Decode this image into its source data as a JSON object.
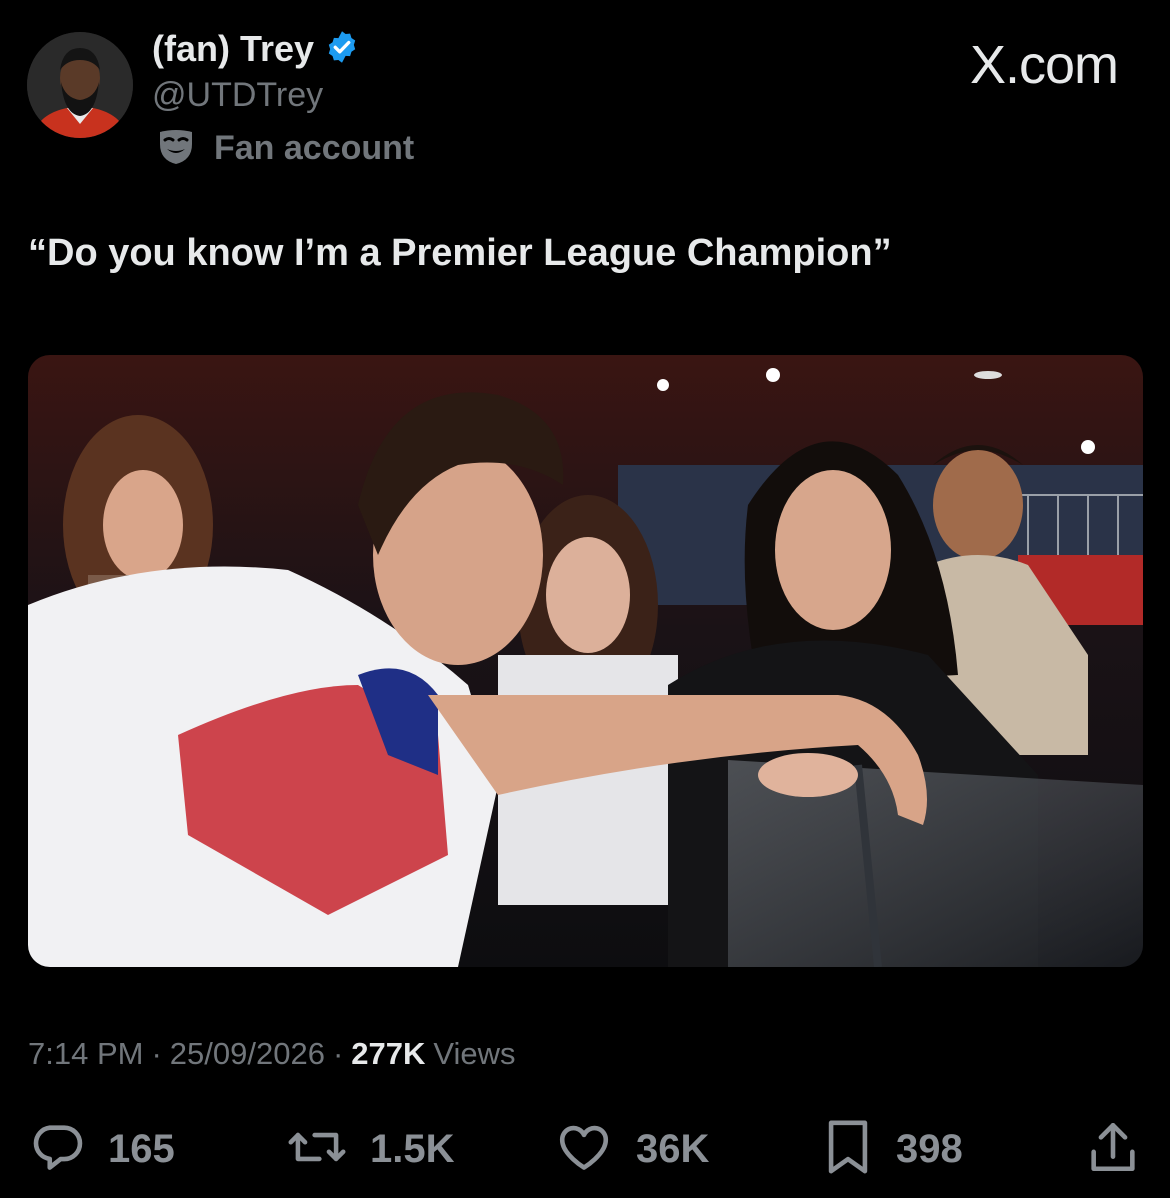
{
  "header": {
    "display_name": "(fan) Trey",
    "handle": "@UTDTrey",
    "label": "Fan account",
    "brand": "X.com",
    "verified_color": "#1d9bf0"
  },
  "tweet": {
    "text": "“Do you know I’m a Premier League Champion”",
    "media_alt": "Photo of a player in a white training shirt leaning on a glass barrier talking to fans in a stadium"
  },
  "meta": {
    "time": "7:14 PM",
    "separator": "·",
    "date": "25/09/2026",
    "views_count": "277K",
    "views_label": "Views"
  },
  "actions": {
    "replies": "165",
    "reposts": "1.5K",
    "likes": "36K",
    "bookmarks": "398"
  },
  "icons": [
    "verified-badge-icon",
    "fan-mask-icon",
    "reply-icon",
    "repost-icon",
    "like-icon",
    "bookmark-icon",
    "share-icon"
  ]
}
